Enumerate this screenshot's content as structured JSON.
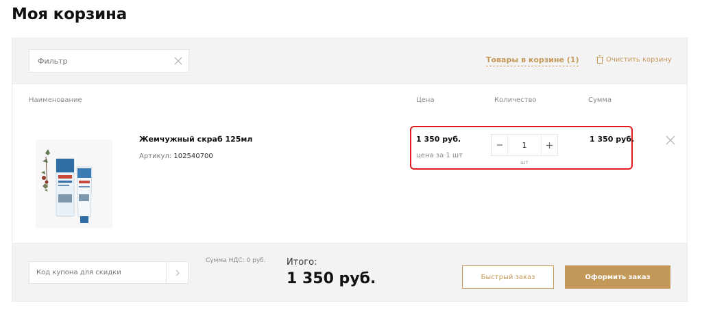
{
  "page": {
    "title": "Моя корзина"
  },
  "filter": {
    "placeholder": "Фильтр"
  },
  "tabs": {
    "in_cart": "Товары в корзине (1)"
  },
  "clear_cart": {
    "label": "Очистить корзину",
    "icon": "trash-icon"
  },
  "columns": {
    "name": "Наименование",
    "price": "Цена",
    "quantity": "Количество",
    "sum": "Сумма"
  },
  "item": {
    "name": "Жемчужный скраб 125мл",
    "sku_label": "Артикул:",
    "sku": "102540700",
    "price": "1 350 руб.",
    "price_note": "цена за 1 шт",
    "quantity": "1",
    "unit": "шт",
    "sum": "1 350 руб."
  },
  "coupon": {
    "placeholder": "Код купона для скидки"
  },
  "summary": {
    "vat": "Сумма НДС: 0 руб.",
    "total_label": "Итого:",
    "total_value": "1 350 руб."
  },
  "actions": {
    "quick_order": "Быстрый заказ",
    "checkout": "Оформить заказ"
  },
  "colors": {
    "accent": "#c49858",
    "highlight": "#e0191b",
    "panel": "#f3f3f3"
  }
}
